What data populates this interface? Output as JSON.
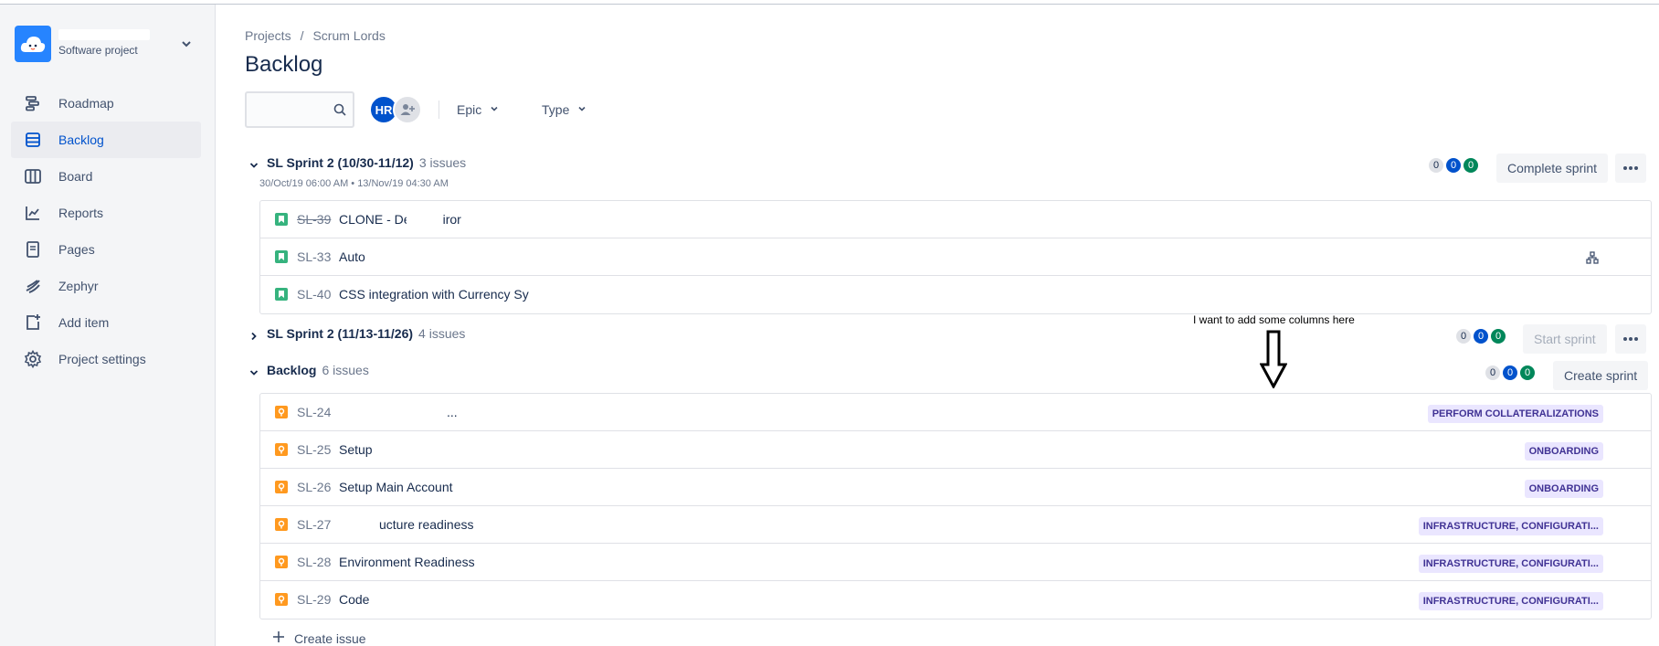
{
  "project": {
    "type_label": "Software project"
  },
  "sidebar": {
    "items": [
      {
        "label": "Roadmap",
        "icon": "roadmap-icon"
      },
      {
        "label": "Backlog",
        "icon": "backlog-icon",
        "active": true
      },
      {
        "label": "Board",
        "icon": "board-icon"
      },
      {
        "label": "Reports",
        "icon": "reports-icon"
      },
      {
        "label": "Pages",
        "icon": "pages-icon"
      },
      {
        "label": "Zephyr",
        "icon": "zephyr-icon"
      },
      {
        "label": "Add item",
        "icon": "add-item-icon"
      },
      {
        "label": "Project settings",
        "icon": "settings-icon"
      }
    ]
  },
  "breadcrumb": {
    "root": "Projects",
    "separator": "/",
    "current": "Scrum Lords"
  },
  "page_title": "Backlog",
  "toolbar": {
    "search_value": "",
    "avatar_initials": "HR",
    "filter_epic": "Epic",
    "filter_type": "Type"
  },
  "sprint1": {
    "title": "SL Sprint 2 (10/30-11/12)",
    "count": "3 issues",
    "dates": "30/Oct/19 06:00 AM • 13/Nov/19 04:30 AM",
    "counts": [
      "0",
      "0",
      "0"
    ],
    "action": "Complete sprint",
    "issues": [
      {
        "key": "SL-39",
        "summary": "CLONE - Dev Enviror",
        "type": "story",
        "done": true
      },
      {
        "key": "SL-33",
        "summary": "Auto",
        "type": "story",
        "done": false
      },
      {
        "key": "SL-40",
        "summary": "CSS integration with Currency Sy",
        "type": "story",
        "done": false
      }
    ]
  },
  "sprint2": {
    "title": "SL Sprint 2 (11/13-11/26)",
    "count": "4 issues",
    "counts": [
      "0",
      "0",
      "0"
    ],
    "action": "Start sprint"
  },
  "backlog": {
    "title": "Backlog",
    "count": "6 issues",
    "counts": [
      "0",
      "0",
      "0"
    ],
    "action": "Create sprint",
    "issues": [
      {
        "key": "SL-24",
        "summary": "...",
        "epic": "PERFORM COLLATERALIZATIONS"
      },
      {
        "key": "SL-25",
        "summary": "Setup",
        "epic": "ONBOARDING"
      },
      {
        "key": "SL-26",
        "summary": "Setup Main Account",
        "epic": "ONBOARDING"
      },
      {
        "key": "SL-27",
        "summary": "ucture readiness",
        "epic": "INFRASTRUCTURE, CONFIGURATI..."
      },
      {
        "key": "SL-28",
        "summary": "Environment Readiness",
        "epic": "INFRASTRUCTURE, CONFIGURATI..."
      },
      {
        "key": "SL-29",
        "summary": "Code",
        "epic": "INFRASTRUCTURE, CONFIGURATI..."
      }
    ]
  },
  "annotation": "I want to add some columns here",
  "create_issue": "Create issue",
  "colors": {
    "brand": "#0052cc",
    "sidebar_bg": "#f4f5f7",
    "epic_bg": "#eae6ff",
    "epic_text": "#403294",
    "story": "#36b37e",
    "bug": "#ff991f"
  }
}
